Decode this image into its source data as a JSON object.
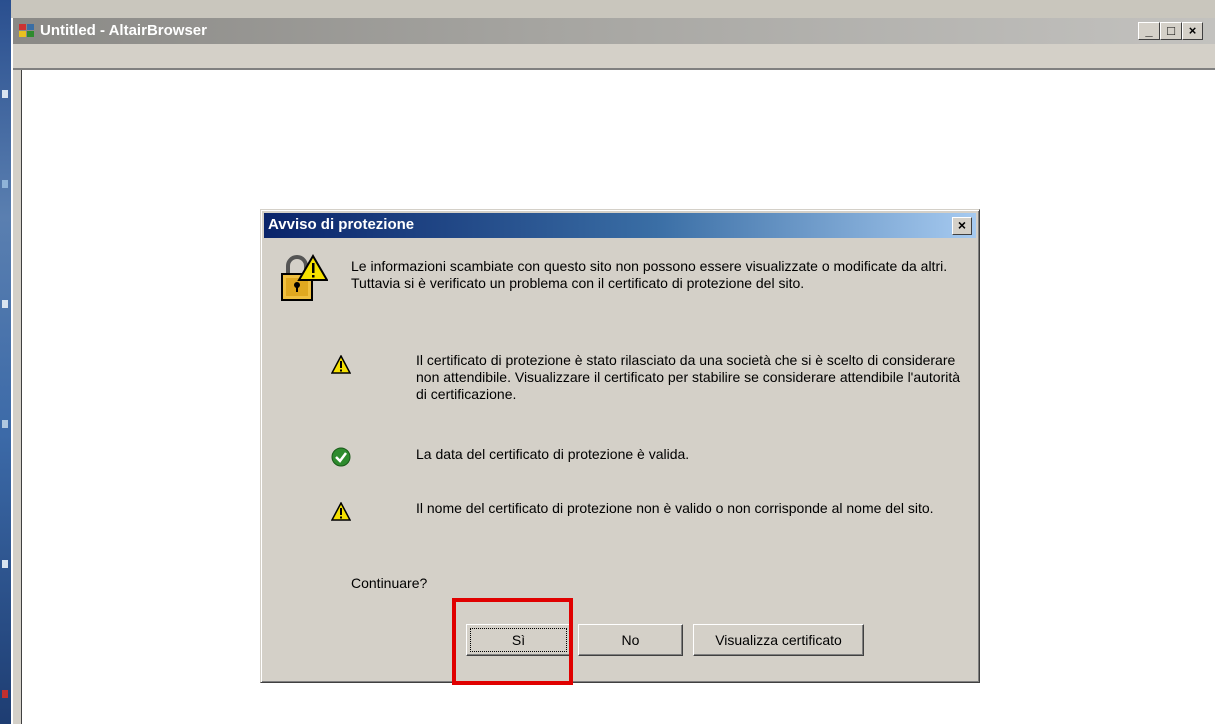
{
  "window": {
    "title": "Untitled - AltairBrowser",
    "controls": {
      "minimize": "_",
      "maximize": "□",
      "close": "×"
    }
  },
  "dialog": {
    "title": "Avviso di protezione",
    "close_label": "×",
    "intro": "Le informazioni scambiate con questo sito non possono essere visualizzate o modificate da altri. Tuttavia si è verificato un problema con il certificato di protezione del sito.",
    "items": [
      {
        "icon": "warning-icon",
        "text": "Il certificato di protezione è stato rilasciato da una società che si è scelto di considerare non attendibile. Visualizzare il certificato per stabilire se considerare attendibile l'autorità di certificazione."
      },
      {
        "icon": "check-icon",
        "text": "La data del certificato di protezione è valida."
      },
      {
        "icon": "warning-icon",
        "text": "Il nome del certificato di protezione non è valido o non corrisponde al nome del sito."
      }
    ],
    "question": "Continuare?",
    "buttons": {
      "yes": "Sì",
      "no": "No",
      "view_certificate": "Visualizza certificato"
    }
  },
  "colors": {
    "dialog_title_gradient_start": "#0a246a",
    "highlight": "#e00000",
    "warning": "#f5e000",
    "check": "#2e8b2e"
  }
}
